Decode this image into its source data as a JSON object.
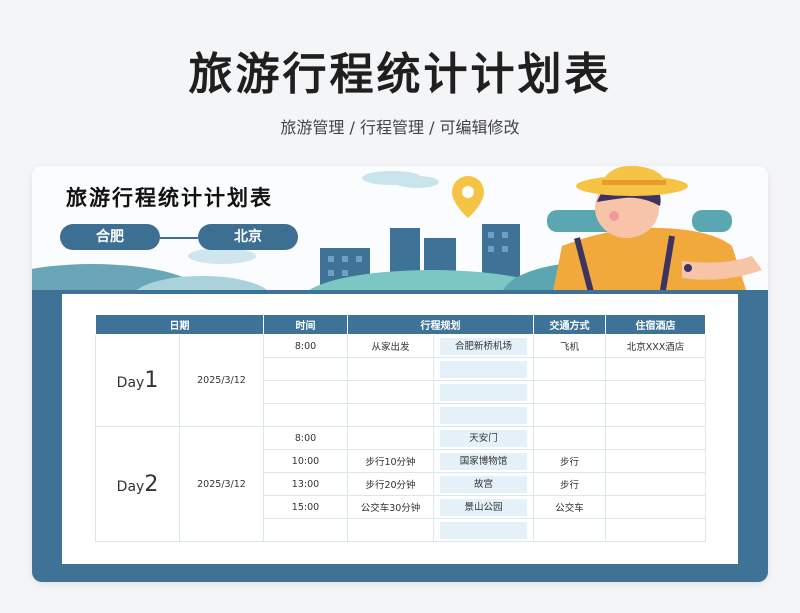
{
  "page": {
    "title": "旅游行程统计计划表",
    "subtitle": "旅游管理 / 行程管理 /  可编辑修改"
  },
  "sheet": {
    "title": "旅游行程统计计划表",
    "from": "合肥",
    "to": "北京"
  },
  "colors": {
    "primary": "#3e7397",
    "cell_highlight": "#e4f1f8"
  },
  "table": {
    "headers": [
      "日期",
      "时间",
      "行程规划",
      "交通方式",
      "住宿酒店"
    ],
    "days": [
      {
        "label": "Day",
        "number": "1",
        "date": "2025/3/12",
        "rows": [
          {
            "time": "8:00",
            "plan": "从家出发",
            "place": "合肥新桥机场",
            "transport": "飞机",
            "hotel": "北京XXX酒店"
          },
          {
            "time": "",
            "plan": "",
            "place": "",
            "transport": "",
            "hotel": ""
          },
          {
            "time": "",
            "plan": "",
            "place": "",
            "transport": "",
            "hotel": ""
          },
          {
            "time": "",
            "plan": "",
            "place": "",
            "transport": "",
            "hotel": ""
          }
        ]
      },
      {
        "label": "Day",
        "number": "2",
        "date": "2025/3/12",
        "rows": [
          {
            "time": "8:00",
            "plan": "",
            "place": "天安门",
            "transport": "",
            "hotel": ""
          },
          {
            "time": "10:00",
            "plan": "步行10分钟",
            "place": "国家博物馆",
            "transport": "步行",
            "hotel": ""
          },
          {
            "time": "13:00",
            "plan": "步行20分钟",
            "place": "故宫",
            "transport": "步行",
            "hotel": ""
          },
          {
            "time": "15:00",
            "plan": "公交车30分钟",
            "place": "景山公园",
            "transport": "公交车",
            "hotel": ""
          },
          {
            "time": "",
            "plan": "",
            "place": "",
            "transport": "",
            "hotel": ""
          }
        ]
      }
    ]
  }
}
